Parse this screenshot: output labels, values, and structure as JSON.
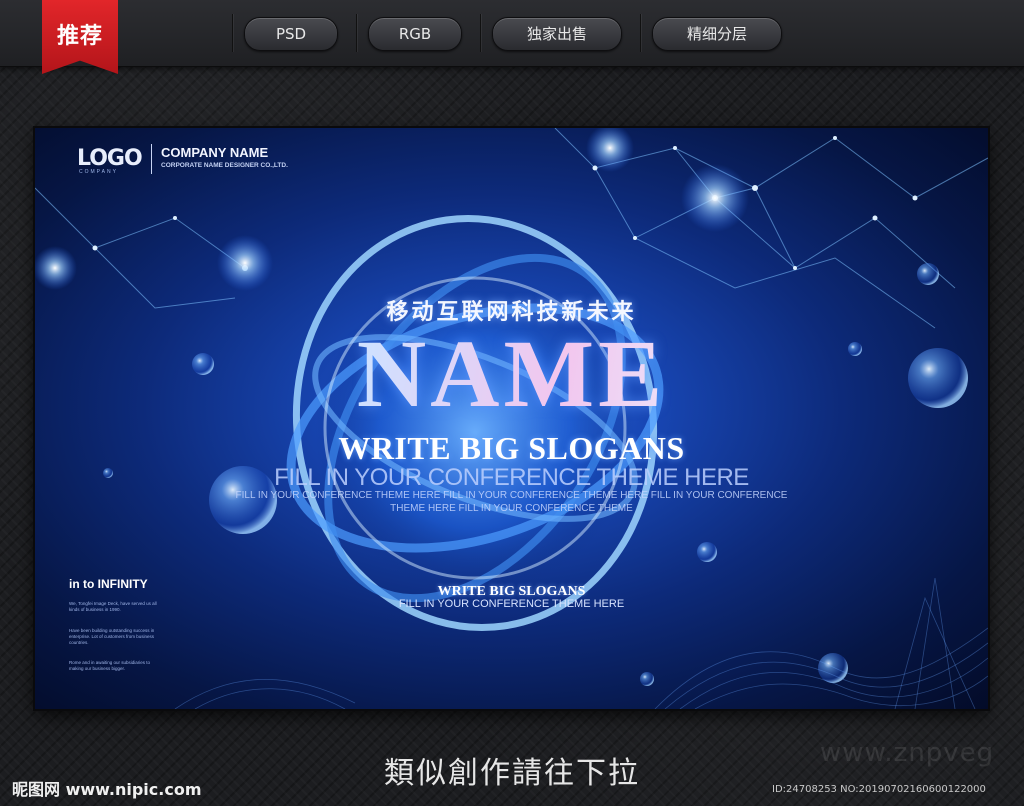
{
  "ribbon": {
    "label": "推荐"
  },
  "tags": [
    "PSD",
    "RGB",
    "独家出售",
    "精细分层"
  ],
  "poster": {
    "logo_mark": "LOGO",
    "logo_sub": "COMPANY",
    "company_name": "COMPANY NAME",
    "company_sub": "CORPORATE NAME DESIGNER CO.,LTD.",
    "cn_headline": "移动互联网科技新未来",
    "big_name": "NAME",
    "slogan_main": "WRITE BIG SLOGANS",
    "theme_main": "FILL IN YOUR CONFERENCE THEME HERE",
    "theme_line_1": "FILL IN YOUR CONFERENCE THEME HERE FILL IN YOUR CONFERENCE THEME HERE FILL IN YOUR CONFERENCE",
    "theme_line_2": "THEME HERE FILL IN YOUR CONFERENCE THEME",
    "slogan_small": "WRITE BIG SLOGANS",
    "theme_small": "FILL IN YOUR CONFERENCE THEME HERE",
    "infinity_label": "in to INFINITY",
    "copy_1": "We, Tongfei Image Deck, have served us all kinds of business in 1990.",
    "copy_2": "Have been building outstanding success in enterprise. Lot of customers from business countries.",
    "copy_3": "Rome and in awaiting our subsidiaries to making our business bigger."
  },
  "footer": {
    "caption": "類似創作請往下拉",
    "site": "昵图网 www.nipic.com",
    "watermark": "www.znpveg",
    "id_line": "ID:24708253 NO:20190702160600122000"
  },
  "colors": {
    "ribbon": "#d01c21",
    "poster_deep": "#061645",
    "poster_glow": "#2f6fe0",
    "page_bg": "#1c1d20"
  }
}
